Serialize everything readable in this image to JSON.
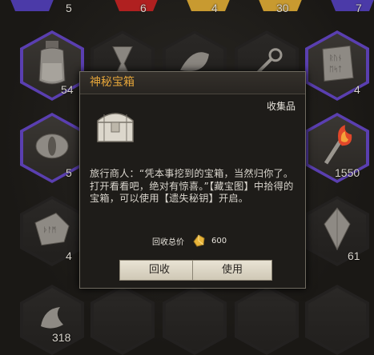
{
  "inventory": {
    "top_row_counts": [
      "5",
      "6",
      "4",
      "30",
      "7"
    ],
    "row1_counts": [
      "54",
      "4"
    ],
    "row2_counts": [
      "5",
      "1550"
    ],
    "row3_counts": [
      "4",
      "61"
    ],
    "row4_counts": [
      "318"
    ]
  },
  "dialog": {
    "title": "神秘宝箱",
    "category": "收集品",
    "description": "旅行商人：“凭本事挖到的宝箱，当然归你了。打开看看吧，绝对有惊喜。”【藏宝图】中拾得的宝箱，可以使用【遗失秘钥】开启。",
    "price_label": "回收总价",
    "price_value": "600",
    "recycle_button": "回收",
    "use_button": "使用"
  },
  "colors": {
    "title_accent": "#e3a43a",
    "rare_border": "#5a3fb0"
  }
}
